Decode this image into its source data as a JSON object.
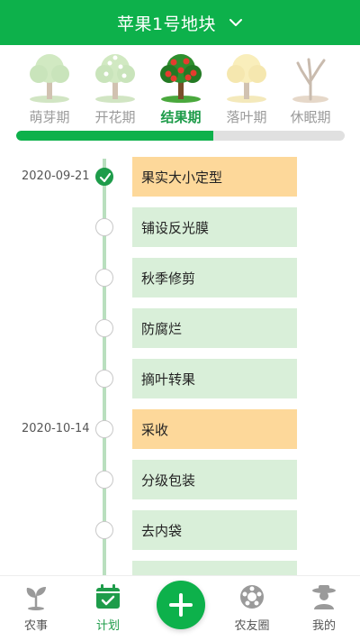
{
  "header": {
    "title": "苹果1号地块"
  },
  "stages": [
    {
      "label": "萌芽期",
      "active": false
    },
    {
      "label": "开花期",
      "active": false
    },
    {
      "label": "结果期",
      "active": true
    },
    {
      "label": "落叶期",
      "active": false
    },
    {
      "label": "休眠期",
      "active": false
    }
  ],
  "progress": {
    "fraction": 0.6
  },
  "timeline": [
    {
      "date": "2020-09-21",
      "task": "果实大小定型",
      "done": true,
      "highlight": true
    },
    {
      "date": "",
      "task": "铺设反光膜",
      "done": false,
      "highlight": false
    },
    {
      "date": "",
      "task": "秋季修剪",
      "done": false,
      "highlight": false
    },
    {
      "date": "",
      "task": "防腐烂",
      "done": false,
      "highlight": false
    },
    {
      "date": "",
      "task": "摘叶转果",
      "done": false,
      "highlight": false
    },
    {
      "date": "2020-10-14",
      "task": "采收",
      "done": false,
      "highlight": true
    },
    {
      "date": "",
      "task": "分级包装",
      "done": false,
      "highlight": false
    },
    {
      "date": "",
      "task": "去内袋",
      "done": false,
      "highlight": false
    }
  ],
  "nav": {
    "items": [
      {
        "label": "农事",
        "icon": "sprout-icon",
        "active": false
      },
      {
        "label": "计划",
        "icon": "calendar-check-icon",
        "active": true
      },
      {
        "label": "农友圈",
        "icon": "community-icon",
        "active": false
      },
      {
        "label": "我的",
        "icon": "farmer-profile-icon",
        "active": false
      }
    ],
    "fab_icon": "plus-icon"
  },
  "colors": {
    "primary": "#0db14b",
    "accent_text": "#1e9c4a",
    "task_bg": "#d9efd9",
    "key_task_bg": "#fdd89a",
    "timeline_line": "#b9dfbe"
  }
}
